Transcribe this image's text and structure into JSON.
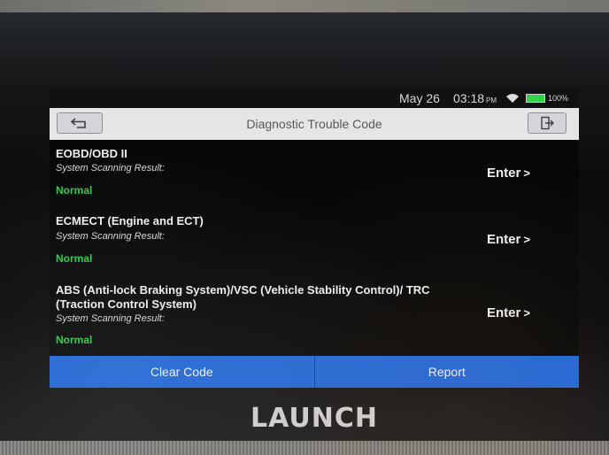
{
  "status_bar": {
    "date": "May 26",
    "time": "03:18",
    "ampm": "PM",
    "battery_text": "100%",
    "battery_level": 1.0,
    "battery_color": "#31d14a"
  },
  "header": {
    "title": "Diagnostic Trouble Code",
    "back_icon": "back-arrow-icon",
    "exit_icon": "exit-icon"
  },
  "systems": [
    {
      "name": "EOBD/OBD II",
      "result_label": "System Scanning Result:",
      "status": "Normal",
      "enter_label": "Enter"
    },
    {
      "name": "ECMECT (Engine and ECT)",
      "result_label": "System Scanning Result:",
      "status": "Normal",
      "enter_label": "Enter"
    },
    {
      "name": "ABS (Anti-lock Braking System)/VSC (Vehicle Stability Control)/ TRC (Traction Control System)",
      "result_label": "System Scanning Result:",
      "status": "Normal",
      "enter_label": "Enter"
    }
  ],
  "footer": {
    "clear_label": "Clear Code",
    "report_label": "Report"
  },
  "device": {
    "brand": "LAUNCH"
  },
  "colors": {
    "accent": "#1f67d8",
    "status_ok": "#2fc94a",
    "title_bar": "#e4e5e7"
  }
}
